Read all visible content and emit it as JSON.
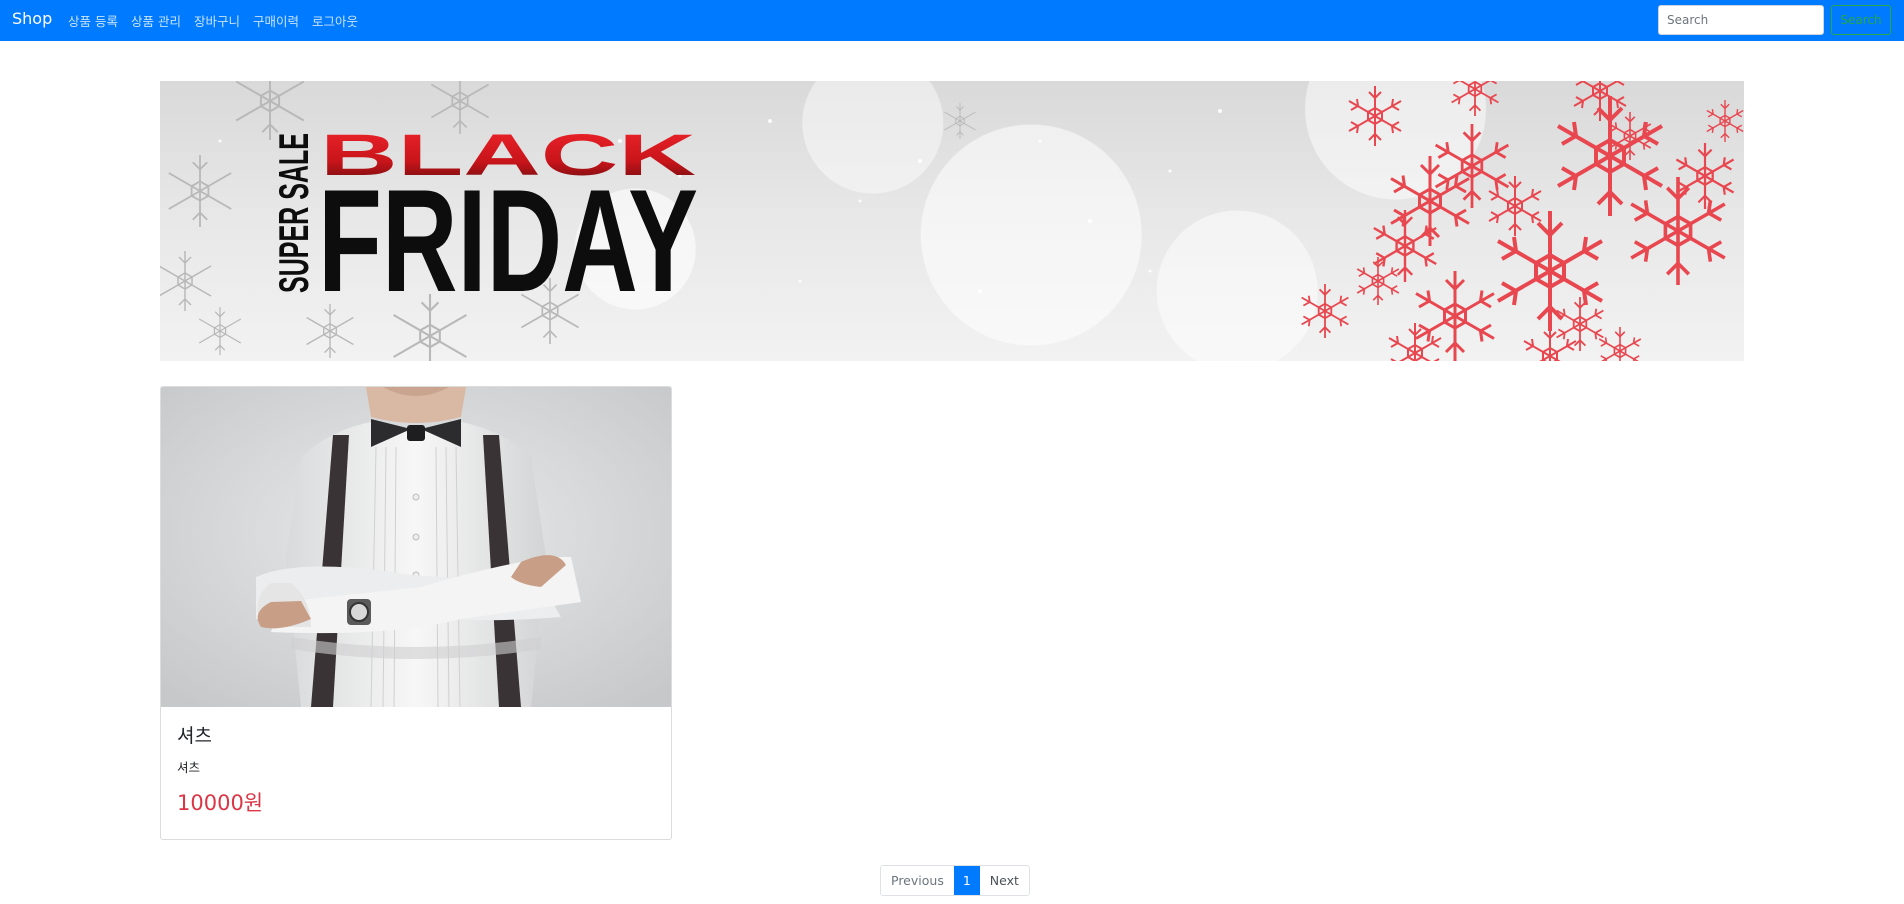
{
  "navbar": {
    "brand": "Shop",
    "links": [
      "상품 등록",
      "상품 관리",
      "장바구니",
      "구매이력",
      "로그아웃"
    ],
    "search_placeholder": "Search",
    "search_button": "Search"
  },
  "banner": {
    "headline_top": "BLACK",
    "headline_bottom": "FRIDAY",
    "side_text": "SUPER SALE"
  },
  "products": [
    {
      "name": "셔츠",
      "description": "셔츠",
      "price": "10000원"
    }
  ],
  "pagination": {
    "previous": "Previous",
    "current": "1",
    "next": "Next"
  },
  "colors": {
    "navbar": "#007bff",
    "price": "#dc3545",
    "search_button": "#28a745",
    "banner_red": "#d9141c"
  }
}
